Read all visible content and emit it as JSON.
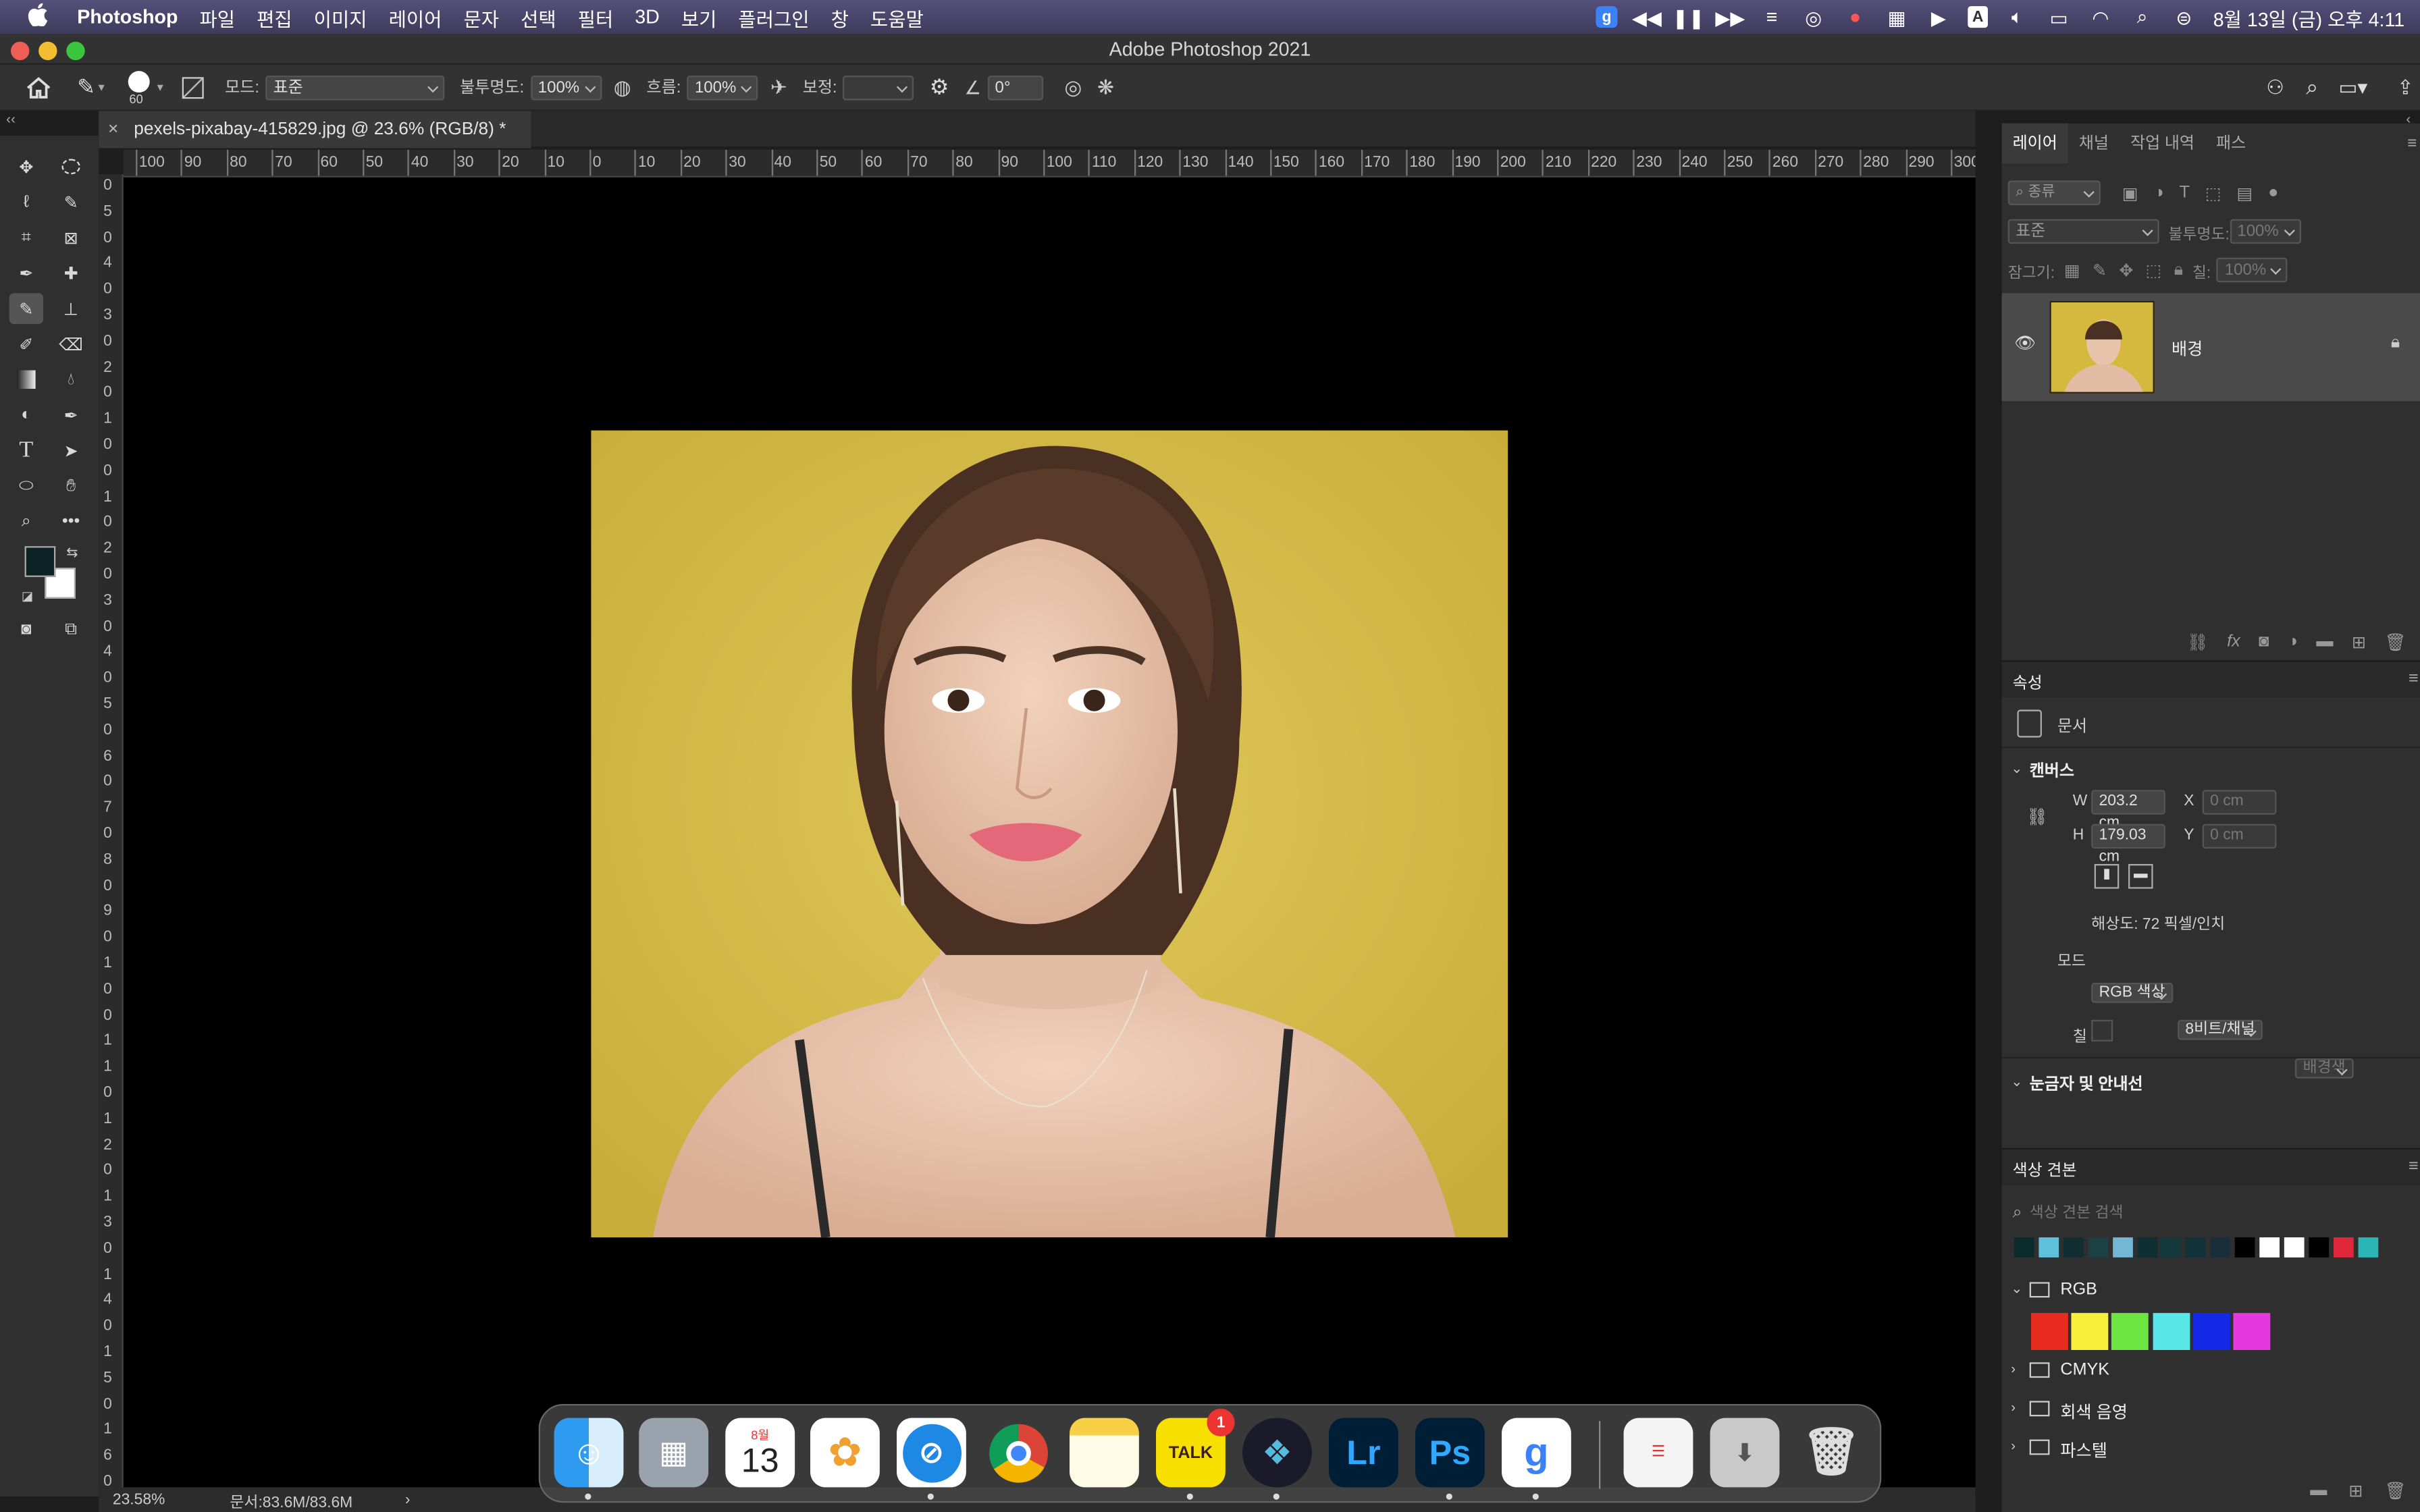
{
  "menubar": {
    "apple": "",
    "app": "Photoshop",
    "items": [
      "파일",
      "편집",
      "이미지",
      "레이어",
      "문자",
      "선택",
      "필터",
      "3D",
      "보기",
      "플러그인",
      "창",
      "도움말"
    ],
    "clock": "8월 13일 (금) 오후 4:11"
  },
  "window": {
    "title": "Adobe Photoshop 2021"
  },
  "options": {
    "brush_size": "60",
    "mode_label": "모드:",
    "mode_value": "표준",
    "opacity_label": "불투명도:",
    "opacity_value": "100%",
    "flow_label": "흐름:",
    "flow_value": "100%",
    "smoothing_label": "보정:",
    "smoothing_value": "",
    "angle_value": "0°"
  },
  "document": {
    "tab_title": "pexels-pixabay-415829.jpg @ 23.6% (RGB/8) *",
    "close": "×"
  },
  "rulers": {
    "h": [
      "100",
      "90",
      "80",
      "70",
      "60",
      "50",
      "40",
      "30",
      "20",
      "10",
      "0",
      "10",
      "20",
      "30",
      "40",
      "50",
      "60",
      "70",
      "80",
      "90",
      "100",
      "110",
      "120",
      "130",
      "140",
      "150",
      "160",
      "170",
      "180",
      "190",
      "200",
      "210",
      "220",
      "230",
      "240",
      "250",
      "260",
      "270",
      "280",
      "290",
      "300"
    ],
    "v": [
      "0",
      "5",
      "0",
      "4",
      "0",
      "3",
      "0",
      "2",
      "0",
      "1",
      "0",
      "0",
      "1",
      "0",
      "2",
      "0",
      "3",
      "0",
      "4",
      "0",
      "5",
      "0",
      "6",
      "0",
      "7",
      "0",
      "8",
      "0",
      "9",
      "0",
      "1",
      "0",
      "0",
      "1",
      "1",
      "0",
      "1",
      "2",
      "0",
      "1",
      "3",
      "0",
      "1",
      "4",
      "0",
      "1",
      "5",
      "0",
      "1",
      "6",
      "0"
    ]
  },
  "status": {
    "zoom": "23.58%",
    "doc": "문서:83.6M/83.6M",
    "arrow": "›"
  },
  "layers_panel": {
    "tabs": [
      "레이어",
      "채널",
      "작업 내역",
      "패스"
    ],
    "filter_label": "종류",
    "blend_mode": "표준",
    "opacity_label": "불투명도:",
    "opacity_value": "100%",
    "lock_label": "잠그기:",
    "fill_label": "칠:",
    "fill_value": "100%",
    "layer_name": "배경"
  },
  "properties_panel": {
    "title": "속성",
    "doc_label": "문서",
    "canvas_section": "캔버스",
    "w_label": "W",
    "w_value": "203.2 cm",
    "h_label": "H",
    "h_value": "179.03 cm",
    "x_label": "X",
    "x_placeholder": "0 cm",
    "y_label": "Y",
    "y_placeholder": "0 cm",
    "resolution": "해상도: 72 픽셀/인치",
    "mode_label": "모드",
    "mode_value": "RGB 색상",
    "depth_value": "8비트/채널",
    "fill_label": "칠",
    "fill_value": "배경색",
    "rulers_section": "눈금자 및 안내선"
  },
  "swatches_panel": {
    "title": "색상 견본",
    "search_placeholder": "색상 견본 검색",
    "recent": [
      "#0b2a2c",
      "#5fc0dc",
      "#112e33",
      "#1d4044",
      "#74b6d6",
      "#0e2f33",
      "#13393d",
      "#103238",
      "#1a2e3a",
      "#000000",
      "#ffffff",
      "#ffffff",
      "#000000",
      "#e0283a",
      "#2bb5b5"
    ],
    "groups": [
      {
        "name": "RGB",
        "colors": [
          "#e82c1f",
          "#f6f03a",
          "#6de543",
          "#58e6e8",
          "#1428e8",
          "#e637e0"
        ]
      },
      {
        "name": "CMYK"
      },
      {
        "name": "회색 음영"
      },
      {
        "name": "파스텔"
      }
    ]
  },
  "dock": {
    "calendar_month": "8월",
    "calendar_day": "13",
    "talk_label": "TALK",
    "talk_badge": "1",
    "lr": "Lr",
    "ps": "Ps",
    "g": "g"
  }
}
